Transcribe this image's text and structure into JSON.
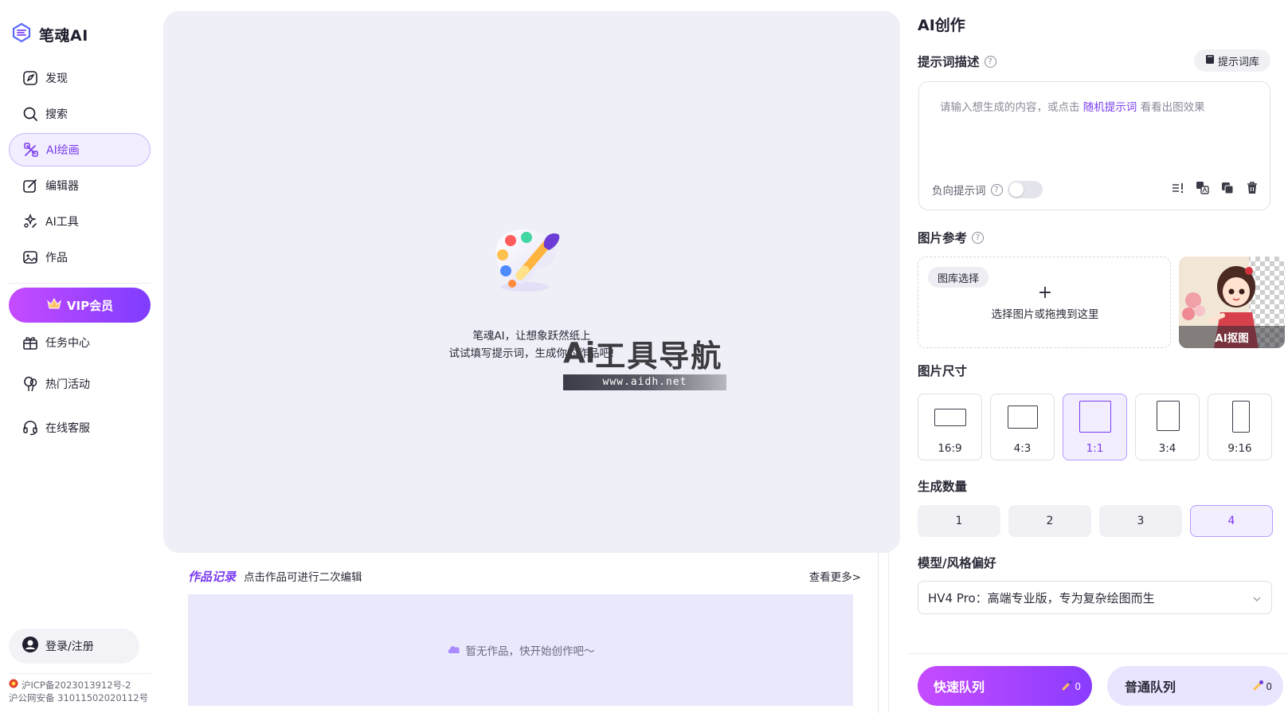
{
  "brand": {
    "name": "笔魂AI"
  },
  "nav": {
    "items": [
      {
        "label": "发现",
        "icon": "discover-icon"
      },
      {
        "label": "搜索",
        "icon": "search-icon"
      },
      {
        "label": "AI绘画",
        "icon": "ai-paint-icon",
        "active": true
      },
      {
        "label": "编辑器",
        "icon": "editor-icon"
      },
      {
        "label": "AI工具",
        "icon": "ai-tools-icon"
      },
      {
        "label": "作品",
        "icon": "works-icon"
      }
    ],
    "vip_label": "VIP会员",
    "extra": [
      {
        "label": "任务中心",
        "icon": "gift-icon"
      },
      {
        "label": "热门活动",
        "icon": "balloon-icon"
      },
      {
        "label": "在线客服",
        "icon": "headset-icon"
      }
    ],
    "login_label": "登录/注册",
    "icp_line1": "沪ICP备2023013912号-2",
    "icp_line2": "沪公网安备 31011502020112号"
  },
  "canvas": {
    "hint_line1": "笔魂AI，让想象跃然纸上",
    "hint_line2": "试试填写提示词，生成你的作品吧!",
    "watermark_title_ai": "Ai",
    "watermark_title_cn": "工具导航",
    "watermark_url": "www.aidh.net"
  },
  "records": {
    "title": "作品记录",
    "subtitle": "点击作品可进行二次编辑",
    "more": "查看更多>",
    "empty": "暂无作品，快开始创作吧～"
  },
  "panel": {
    "title": "AI创作",
    "prompt_label": "提示词描述",
    "prompt_library": "提示词库",
    "prompt_placeholder_pre": "请输入想生成的内容，或点击 ",
    "prompt_placeholder_link": "随机提示词",
    "prompt_placeholder_post": " 看看出图效果",
    "negative_label": "负向提示词",
    "negative_enabled": false,
    "ref_label": "图片参考",
    "gallery_select": "图库选择",
    "drop_plus": "+",
    "drop_text": "选择图片或拖拽到这里",
    "cutout_label": "AI抠图",
    "size_label": "图片尺寸",
    "sizes": [
      {
        "label": "16:9"
      },
      {
        "label": "4:3"
      },
      {
        "label": "1:1",
        "active": true
      },
      {
        "label": "3:4"
      },
      {
        "label": "9:16"
      }
    ],
    "count_label": "生成数量",
    "counts": [
      {
        "label": "1"
      },
      {
        "label": "2"
      },
      {
        "label": "3"
      },
      {
        "label": "4",
        "active": true
      }
    ],
    "model_label": "模型/风格偏好",
    "model_value": "HV4 Pro：高端专业版，专为复杂绘图而生",
    "fast_queue": "快速队列",
    "fast_queue_count": "0",
    "normal_queue": "普通队列",
    "normal_queue_count": "0"
  },
  "colors": {
    "accent": "#7a3cf0",
    "vip_gradient_start": "#c64bff",
    "vip_gradient_end": "#7f3cff",
    "canvas_bg": "#efeff8"
  }
}
